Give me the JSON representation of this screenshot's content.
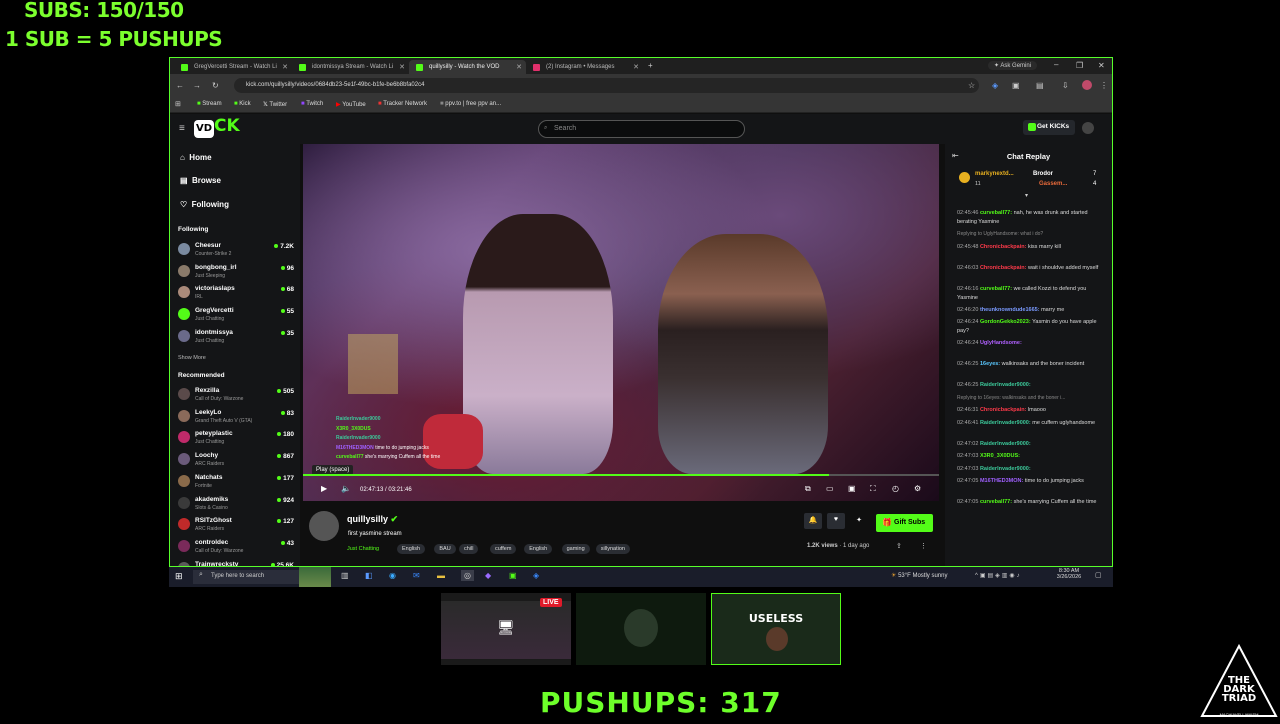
{
  "overlay": {
    "subs": "SUBS: 150/150",
    "rule": "1 SUB = 5 PUSHUPS",
    "pushups": "PUSHUPS: 317",
    "live_badge": "LIVE",
    "useless_label": "USELESS",
    "logo_line1": "THE",
    "logo_line2": "DARK",
    "logo_line3": "TRIAD",
    "logo_bottom": "MACHIAVELLIANISM"
  },
  "browser": {
    "tabs": [
      {
        "label": "GregVercetti Stream - Watch Li",
        "active": false
      },
      {
        "label": "idontmissya Stream - Watch Li",
        "active": false
      },
      {
        "label": "quillysilly - Watch the VOD",
        "active": true
      },
      {
        "label": "(2) Instagram • Messages",
        "active": false
      }
    ],
    "ask_gemini": "Ask Gemini",
    "url": "kick.com/quillysilly/videos/0684db23-5e1f-49bc-b1fe-be6b8bfa02c4",
    "bookmarks": [
      "Stream",
      "Kick",
      "Twitter",
      "Twitch",
      "YouTube",
      "Tracker Network",
      "ppv.to | free ppv an..."
    ]
  },
  "kick": {
    "search_placeholder": "Search",
    "get_kicks": "Get KICKs",
    "nav": [
      "Home",
      "Browse",
      "Following"
    ],
    "following_heading": "Following",
    "following": [
      {
        "name": "Cheesur",
        "cat": "Counter-Strike 2",
        "viewers": "7.2K",
        "color": "#7a8aa0"
      },
      {
        "name": "bongbong_irl",
        "cat": "Just Sleeping",
        "viewers": "96",
        "color": "#8a7a6a"
      },
      {
        "name": "victoriaslaps",
        "cat": "IRL",
        "viewers": "68",
        "color": "#aa8a7a"
      },
      {
        "name": "GregVercetti",
        "cat": "Just Chatting",
        "viewers": "55",
        "color": "#53fc18"
      },
      {
        "name": "idontmissya",
        "cat": "Just Chatting",
        "viewers": "35",
        "color": "#6a6a8a"
      }
    ],
    "show_more": "Show More",
    "recommended_heading": "Recommended",
    "recommended": [
      {
        "name": "Rexzilla",
        "cat": "Call of Duty: Warzone",
        "viewers": "505",
        "color": "#5a4a4a"
      },
      {
        "name": "LeekyLo",
        "cat": "Grand Theft Auto V (GTA)",
        "viewers": "83",
        "color": "#8a6a5a"
      },
      {
        "name": "peteyplastic",
        "cat": "Just Chatting",
        "viewers": "180",
        "color": "#c02a6a"
      },
      {
        "name": "Loochy",
        "cat": "ARC Raiders",
        "viewers": "867",
        "color": "#6a5a7a"
      },
      {
        "name": "Natchats",
        "cat": "Fortnite",
        "viewers": "177",
        "color": "#8a6a4a"
      },
      {
        "name": "akademiks",
        "cat": "Slots & Casino",
        "viewers": "924",
        "color": "#3a3a3a"
      },
      {
        "name": "RSITzGhost",
        "cat": "ARC Raiders",
        "viewers": "127",
        "color": "#c02a2a"
      },
      {
        "name": "controldec",
        "cat": "Call of Duty: Warzone",
        "viewers": "43",
        "color": "#7a2a5a"
      },
      {
        "name": "Trainwreckstv",
        "cat": "",
        "viewers": "25.6K",
        "color": "#5a5a5a"
      }
    ],
    "player": {
      "tooltip": "Play (space)",
      "time": "02:47:13 / 03:21:46",
      "progress": 0.827
    },
    "video_chat": [
      {
        "user": "RaiderInvader9000",
        "msg": "",
        "color": "#3cc99a"
      },
      {
        "user": "X3R0_3X0DUS",
        "msg": "",
        "color": "#53fc18"
      },
      {
        "user": "RaiderInvader9000",
        "msg": "",
        "color": "#3cc99a"
      },
      {
        "user": "M16THED3MON",
        "msg": "time to do jumping jacks",
        "color": "#a060ff"
      },
      {
        "user": "curveball77",
        "msg": "she's marrying Cuffem all the time",
        "color": "#53fc18"
      }
    ],
    "channel": {
      "name": "quillysilly",
      "title": "first yasmine stream",
      "category": "Just Chatting",
      "tags": [
        "English",
        "BAU",
        "chill",
        "cuffem",
        "English",
        "gaming",
        "sillynation"
      ],
      "views": "1.2K views",
      "age": "1 day ago",
      "gift_subs": "Gift Subs"
    },
    "chat": {
      "title": "Chat Replay",
      "pinned": [
        {
          "user": "markynextd...",
          "count": "11"
        },
        {
          "user": "Brodor",
          "count": "7"
        },
        {
          "user": "Gassem...",
          "count": "4"
        }
      ],
      "messages": [
        {
          "ts": "02:45:46",
          "user": "curveball77:",
          "msg": "nah, he was drunk and started berating Yasmine",
          "color": "#53fc18"
        },
        {
          "ts": "",
          "user": "",
          "msg": "Replying to UglyHandsome: what i do?",
          "color": "#888"
        },
        {
          "ts": "02:45:48",
          "user": "Chronicbackpain:",
          "msg": "kiss marry kill",
          "color": "#ff3a4a"
        },
        {
          "ts": "02:46:03",
          "user": "Chronicbackpain:",
          "msg": "wait i shouldve added myself",
          "color": "#ff3a4a"
        },
        {
          "ts": "02:46:16",
          "user": "curveball77:",
          "msg": "we called Kozzi to defend you Yasmine",
          "color": "#53fc18"
        },
        {
          "ts": "02:46:20",
          "user": "theunknowndude1665:",
          "msg": "marry me",
          "color": "#7a9aff"
        },
        {
          "ts": "02:46:24",
          "user": "GordonGekko2023:",
          "msg": "Yasmin do you have apple pay?",
          "color": "#53fc18"
        },
        {
          "ts": "02:46:24",
          "user": "UglyHandsome:",
          "msg": "",
          "color": "#b060ff"
        },
        {
          "ts": "02:46:25",
          "user": "16eyes:",
          "msg": "walkinsaks and the boner incident",
          "color": "#5ac8ff"
        },
        {
          "ts": "02:46:25",
          "user": "RaiderInvader9000:",
          "msg": "",
          "color": "#3cc99a"
        },
        {
          "ts": "",
          "user": "",
          "msg": "Replying to 16eyes: walkinsaks and the boner i...",
          "color": "#888"
        },
        {
          "ts": "02:46:31",
          "user": "Chronicbackpain:",
          "msg": "lmaooo",
          "color": "#ff3a4a"
        },
        {
          "ts": "02:46:41",
          "user": "RaiderInvader9000:",
          "msg": "me cuffem uglyhandsome",
          "color": "#3cc99a"
        },
        {
          "ts": "02:47:02",
          "user": "RaiderInvader9000:",
          "msg": "",
          "color": "#3cc99a"
        },
        {
          "ts": "02:47:03",
          "user": "X3R0_3X0DUS:",
          "msg": "",
          "color": "#53fc18"
        },
        {
          "ts": "02:47:03",
          "user": "RaiderInvader9000:",
          "msg": "",
          "color": "#3cc99a"
        },
        {
          "ts": "02:47:05",
          "user": "M16THED3MON:",
          "msg": "time to do jumping jacks",
          "color": "#a060ff"
        },
        {
          "ts": "02:47:05",
          "user": "curveball77:",
          "msg": "she's marrying Cuffem all the time",
          "color": "#53fc18"
        }
      ]
    }
  },
  "taskbar": {
    "search_placeholder": "Type here to search",
    "weather": "53°F  Mostly sunny",
    "time": "8:30 AM",
    "date": "3/26/2026"
  },
  "colors": {
    "kick_green": "#53fc18",
    "overlay_green": "#7cff2e"
  }
}
